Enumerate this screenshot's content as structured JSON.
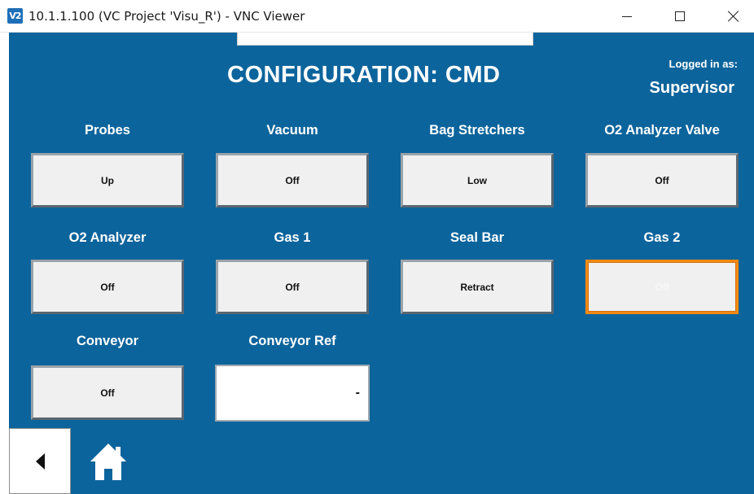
{
  "window": {
    "app_icon": "V2",
    "title": "10.1.1.100 (VC Project 'Visu_R') - VNC Viewer",
    "minimize_icon": "minimize-icon",
    "maximize_icon": "maximize-icon",
    "close_icon": "close-icon"
  },
  "header": {
    "title": "CONFIGURATION: CMD",
    "logged_in_label": "Logged in as:",
    "user": "Supervisor"
  },
  "commands": [
    {
      "label": "Probes",
      "value": "Up"
    },
    {
      "label": "Vacuum",
      "value": "Off"
    },
    {
      "label": "Bag Stretchers",
      "value": "Low"
    },
    {
      "label": "O2 Analyzer Valve",
      "value": "Off"
    },
    {
      "label": "O2 Analyzer",
      "value": "Off"
    },
    {
      "label": "Gas 1",
      "value": "Off"
    },
    {
      "label": "Seal Bar",
      "value": "Retract"
    },
    {
      "label": "Gas 2",
      "value": "Off"
    },
    {
      "label": "Conveyor",
      "value": "Off"
    }
  ],
  "conveyor_ref": {
    "label": "Conveyor Ref",
    "value": "-"
  },
  "nav": {
    "back_icon": "back-arrow-icon",
    "home_icon": "home-icon"
  },
  "colors": {
    "background": "#0c649c",
    "focus_border": "#f28a12"
  }
}
